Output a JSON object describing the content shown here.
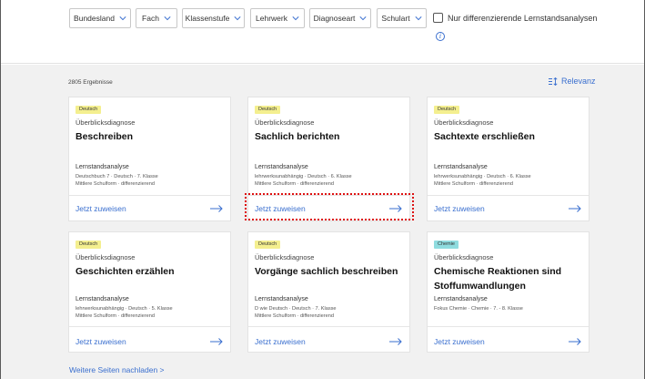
{
  "filters": {
    "bundesland": "Bundesland",
    "fach": "Fach",
    "klassenstufe": "Klassenstufe",
    "lehrwerk": "Lehrwerk",
    "diagnoseart": "Diagnoseart",
    "schulart": "Schulart",
    "checkbox_label": "Nur differenzierende Lernstandsanalysen",
    "info_symbol": "i"
  },
  "results": {
    "count_text": "2805 Ergebnisse",
    "sort_label": "Relevanz",
    "sort_icon": "sort-icon"
  },
  "cards": [
    {
      "badge": "Deutsch",
      "badge_color": "#f4ef8f",
      "kind": "Überblicksdiagnose",
      "title": "Beschreiben",
      "la": "Lernstandsanalyse",
      "meta1": "Deutschbuch 7 · Deutsch · 7. Klasse",
      "meta2": "Mittlere Schulform · differenzierend",
      "action": "Jetzt zuweisen"
    },
    {
      "badge": "Deutsch",
      "badge_color": "#f4ef8f",
      "kind": "Überblicksdiagnose",
      "title": "Sachlich berichten",
      "la": "Lernstandsanalyse",
      "meta1": "lehrwerksunabhängig · Deutsch · 6. Klasse",
      "meta2": "Mittlere Schulform · differenzierend",
      "action": "Jetzt zuweisen"
    },
    {
      "badge": "Deutsch",
      "badge_color": "#f4ef8f",
      "kind": "Überblicksdiagnose",
      "title": "Sachtexte erschließen",
      "la": "Lernstandsanalyse",
      "meta1": "lehrwerksunabhängig · Deutsch · 6. Klasse",
      "meta2": "Mittlere Schulform · differenzierend",
      "action": "Jetzt zuweisen"
    },
    {
      "badge": "Deutsch",
      "badge_color": "#f4ef8f",
      "kind": "Überblicksdiagnose",
      "title": "Geschichten erzählen",
      "la": "Lernstandsanalyse",
      "meta1": "lehrwerksunabhängig · Deutsch · 5. Klasse",
      "meta2": "Mittlere Schulform · differenzierend",
      "action": "Jetzt zuweisen"
    },
    {
      "badge": "Deutsch",
      "badge_color": "#f4ef8f",
      "kind": "Überblicksdiagnose",
      "title": "Vorgänge sachlich beschreiben",
      "la": "Lernstandsanalyse",
      "meta1": "D wie Deutsch · Deutsch · 7. Klasse",
      "meta2": "Mittlere Schulform · differenzierend",
      "action": "Jetzt zuweisen"
    },
    {
      "badge": "Chemie",
      "badge_color": "#8fdcdf",
      "kind": "Überblicksdiagnose",
      "title": "Chemische Reaktionen sind Stoffumwandlungen",
      "la": "Lernstandsanalyse",
      "meta1": "Fokus Chemie · Chemie · 7. - 8. Klasse",
      "meta2": "",
      "action": "Jetzt zuweisen"
    }
  ],
  "more_link": "Weitere Seiten nachladen >",
  "colors": {
    "accent": "#3a6fcf",
    "highlight_outline": "#dd1111"
  }
}
